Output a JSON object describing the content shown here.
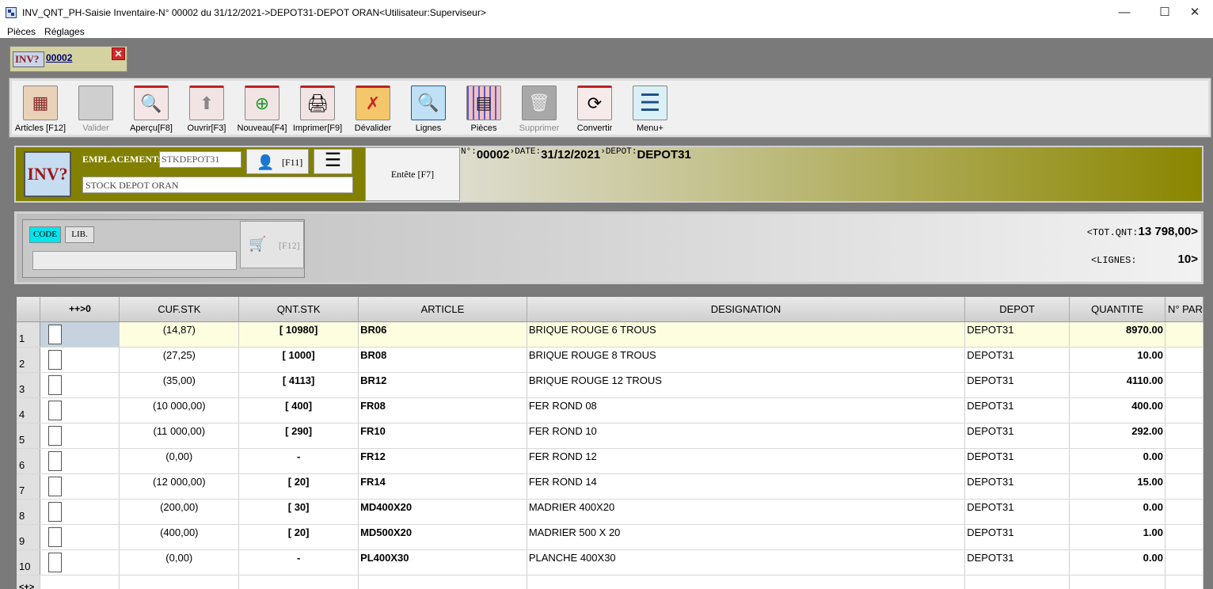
{
  "window": {
    "title": "INV_QNT_PH-Saisie Inventaire-N° 00002 du 31/12/2021->DEPOT31-DEPOT ORAN<Utilisateur:Superviseur>",
    "minimize": "—",
    "maximize": "☐",
    "close": "✕"
  },
  "menu": [
    "Pièces",
    "Réglages"
  ],
  "doc_tab": {
    "icon_text": "INV?",
    "label": "00002",
    "close": "✕"
  },
  "toolbar": [
    {
      "label": "Articles [F12]",
      "icon": "articles-icon",
      "glyph": "▦"
    },
    {
      "label": "Valider",
      "icon": "validate-icon",
      "glyph": "",
      "disabled": true
    },
    {
      "label": "Aperçu[F8]",
      "icon": "preview-icon",
      "glyph": "🔍"
    },
    {
      "label": "Ouvrir[F3]",
      "icon": "open-icon",
      "glyph": "⬆"
    },
    {
      "label": "Nouveau[F4]",
      "icon": "new-icon",
      "glyph": "⊕"
    },
    {
      "label": "Imprimer[F9]",
      "icon": "print-icon",
      "glyph": "🖨"
    },
    {
      "label": "Dévalider",
      "icon": "unvalidate-icon",
      "glyph": "✗"
    },
    {
      "label": "Lignes",
      "icon": "lines-icon",
      "glyph": "🔍"
    },
    {
      "label": "Pièces",
      "icon": "pieces-icon",
      "glyph": "▤"
    },
    {
      "label": "Supprimer",
      "icon": "delete-icon",
      "glyph": "🗑",
      "disabled": true
    },
    {
      "label": "Convertir",
      "icon": "convert-icon",
      "glyph": "⟳"
    },
    {
      "label": "Menu+",
      "icon": "menu-plus-icon",
      "glyph": "☰"
    }
  ],
  "header": {
    "big_icon_text": "INV?",
    "emplacement_label": "EMPLACEMENT:",
    "emplacement_code": "STKDEPOT31",
    "emplacement_name": "STOCK DEPOT ORAN",
    "user_button": "[F11]",
    "entete_button": "Entête [F7]",
    "num_label": "N°:",
    "num_value": "00002",
    "date_label": "›DATE:",
    "date_value": "31/12/2021",
    "depot_label": "›DEPOT:",
    "depot_value": "DEPOT31"
  },
  "search": {
    "mode_code": "CODE",
    "mode_lib": "LIB.",
    "input_value": "",
    "search_button": "[F12]",
    "tot_label": "<TOT.QNT:",
    "tot_value": "13 798,00>",
    "lignes_label": "<LIGNES:",
    "lignes_value": "10>"
  },
  "grid": {
    "columns": [
      "",
      "++>0",
      "CUF.STK",
      "QNT.STK",
      "ARTICLE",
      "DESIGNATION",
      "DEPOT",
      "QUANTITE",
      "N° PAR"
    ],
    "rows": [
      {
        "n": "1",
        "cuf": "(14,87)",
        "qnt": "[ 10980]",
        "article": "BR06",
        "designation": "BRIQUE ROUGE 6 TROUS",
        "depot": "DEPOT31",
        "quantite": "8970.00"
      },
      {
        "n": "2",
        "cuf": "(27,25)",
        "qnt": "[ 1000]",
        "article": "BR08",
        "designation": "BRIQUE ROUGE 8 TROUS",
        "depot": "DEPOT31",
        "quantite": "10.00"
      },
      {
        "n": "3",
        "cuf": "(35,00)",
        "qnt": "[ 4113]",
        "article": "BR12",
        "designation": "BRIQUE ROUGE 12 TROUS",
        "depot": "DEPOT31",
        "quantite": "4110.00"
      },
      {
        "n": "4",
        "cuf": "(10 000,00)",
        "qnt": "[ 400]",
        "article": "FR08",
        "designation": "FER ROND 08",
        "depot": "DEPOT31",
        "quantite": "400.00"
      },
      {
        "n": "5",
        "cuf": "(11 000,00)",
        "qnt": "[ 290]",
        "article": "FR10",
        "designation": "FER ROND 10",
        "depot": "DEPOT31",
        "quantite": "292.00"
      },
      {
        "n": "6",
        "cuf": "(0,00)",
        "qnt": "-",
        "article": "FR12",
        "designation": "FER ROND 12",
        "depot": "DEPOT31",
        "quantite": "0.00"
      },
      {
        "n": "7",
        "cuf": "(12 000,00)",
        "qnt": "[ 20]",
        "article": "FR14",
        "designation": "FER ROND 14",
        "depot": "DEPOT31",
        "quantite": "15.00"
      },
      {
        "n": "8",
        "cuf": "(200,00)",
        "qnt": "[ 30]",
        "article": "MD400X20",
        "designation": "MADRIER 400X20",
        "depot": "DEPOT31",
        "quantite": "0.00"
      },
      {
        "n": "9",
        "cuf": "(400,00)",
        "qnt": "[ 20]",
        "article": "MD500X20",
        "designation": "MADRIER 500 X 20",
        "depot": "DEPOT31",
        "quantite": "1.00"
      },
      {
        "n": "10",
        "cuf": "(0,00)",
        "qnt": "-",
        "article": "PL400X30",
        "designation": "PLANCHE 400X30",
        "depot": "DEPOT31",
        "quantite": "0.00"
      }
    ],
    "nav_label": "<+>"
  }
}
